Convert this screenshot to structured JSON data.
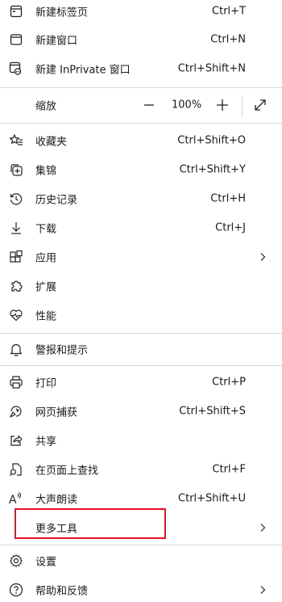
{
  "menu": {
    "new_tab": {
      "label": "新建标签页",
      "shortcut": "Ctrl+T",
      "icon": "new-tab-icon"
    },
    "new_window": {
      "label": "新建窗口",
      "shortcut": "Ctrl+N",
      "icon": "new-window-icon"
    },
    "new_inprivate": {
      "label": "新建 InPrivate 窗口",
      "shortcut": "Ctrl+Shift+N",
      "icon": "inprivate-icon"
    },
    "zoom": {
      "label": "缩放",
      "value": "100%",
      "minus_icon": "minus-icon",
      "plus_icon": "plus-icon",
      "expand_icon": "fullscreen-icon"
    },
    "favorites": {
      "label": "收藏夹",
      "shortcut": "Ctrl+Shift+O",
      "icon": "favorites-icon"
    },
    "collections": {
      "label": "集锦",
      "shortcut": "Ctrl+Shift+Y",
      "icon": "collections-icon"
    },
    "history": {
      "label": "历史记录",
      "shortcut": "Ctrl+H",
      "icon": "history-icon"
    },
    "downloads": {
      "label": "下载",
      "shortcut": "Ctrl+J",
      "icon": "download-icon"
    },
    "apps": {
      "label": "应用",
      "icon": "apps-icon"
    },
    "extensions": {
      "label": "扩展",
      "icon": "extensions-icon"
    },
    "performance": {
      "label": "性能",
      "icon": "performance-icon"
    },
    "alerts": {
      "label": "警报和提示",
      "icon": "bell-icon"
    },
    "print": {
      "label": "打印",
      "shortcut": "Ctrl+P",
      "icon": "print-icon"
    },
    "screenshot": {
      "label": "网页捕获",
      "shortcut": "Ctrl+Shift+S",
      "icon": "web-capture-icon"
    },
    "share": {
      "label": "共享",
      "icon": "share-icon"
    },
    "find": {
      "label": "在页面上查找",
      "shortcut": "Ctrl+F",
      "icon": "find-icon"
    },
    "read_aloud": {
      "label": "大声朗读",
      "shortcut": "Ctrl+Shift+U",
      "icon": "read-aloud-icon"
    },
    "more_tools": {
      "label": "更多工具"
    },
    "settings": {
      "label": "设置",
      "icon": "gear-icon"
    },
    "help": {
      "label": "帮助和反馈",
      "icon": "help-icon"
    }
  },
  "colors": {
    "highlight": "#e81123",
    "divider": "#d6d6d6",
    "text": "#1a1a1a"
  }
}
